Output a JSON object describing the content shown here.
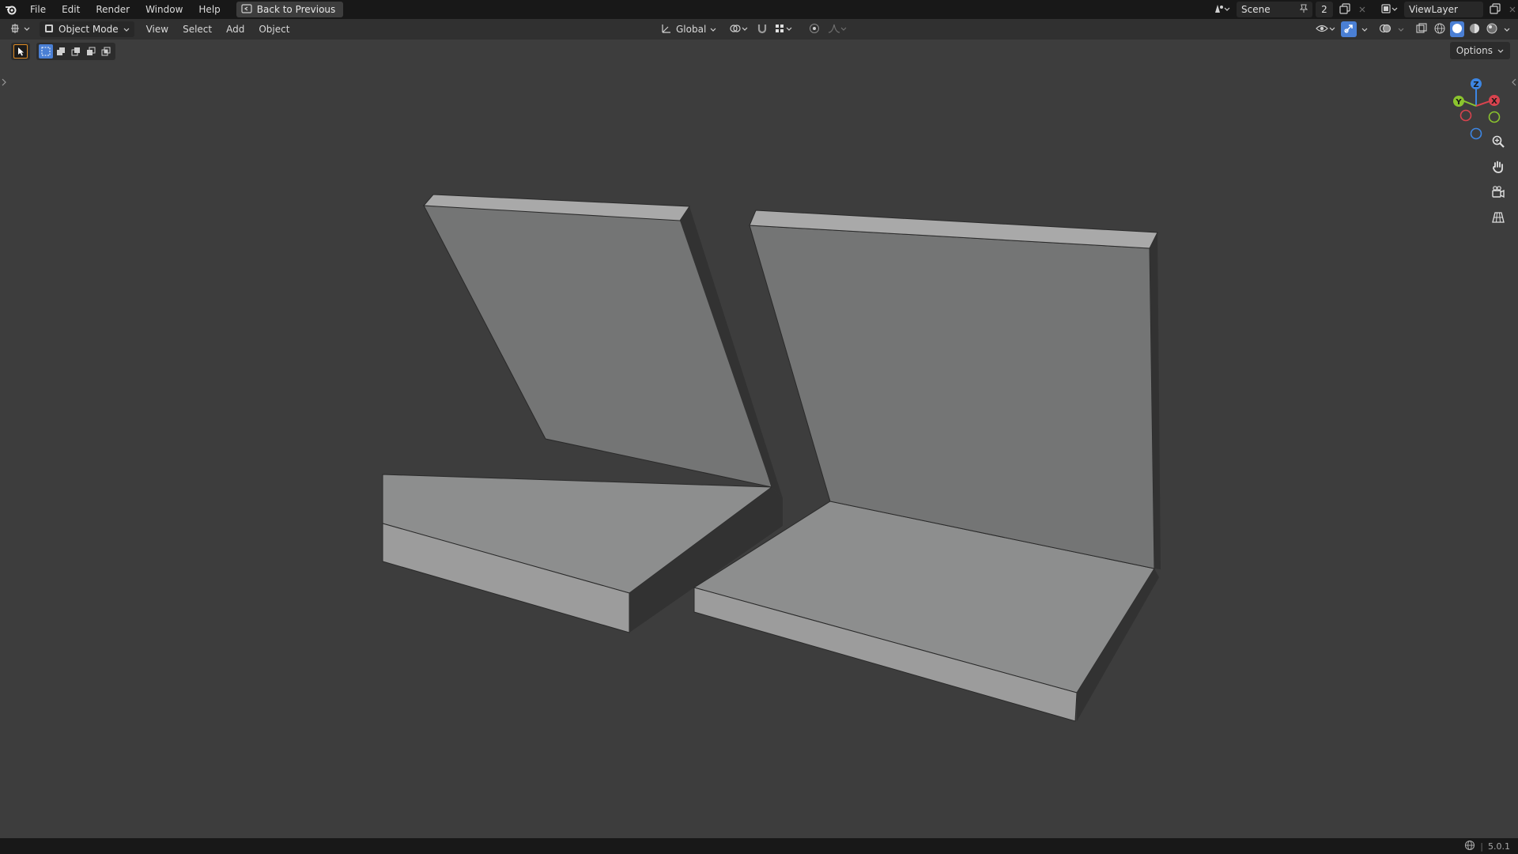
{
  "topbar": {
    "menus": [
      {
        "label": "File"
      },
      {
        "label": "Edit"
      },
      {
        "label": "Render"
      },
      {
        "label": "Window"
      },
      {
        "label": "Help"
      }
    ],
    "back_button": "Back to Previous",
    "scene_name": "Scene",
    "scene_count": "2",
    "view_layer": "ViewLayer"
  },
  "header": {
    "mode": "Object Mode",
    "menus": [
      {
        "label": "View"
      },
      {
        "label": "Select"
      },
      {
        "label": "Add"
      },
      {
        "label": "Object"
      }
    ],
    "transform_orientation": "Global"
  },
  "viewport": {
    "options_label": "Options",
    "gizmo": {
      "x": "X",
      "y": "Y",
      "z": "Z"
    }
  },
  "status": {
    "version": "5.0.1"
  },
  "colors": {
    "viewport_bg": "#3d3d3d",
    "accent": "#4a7fd4",
    "axis_x": "#d8434e",
    "axis_y": "#8bc42e",
    "axis_z": "#3d86e3"
  }
}
